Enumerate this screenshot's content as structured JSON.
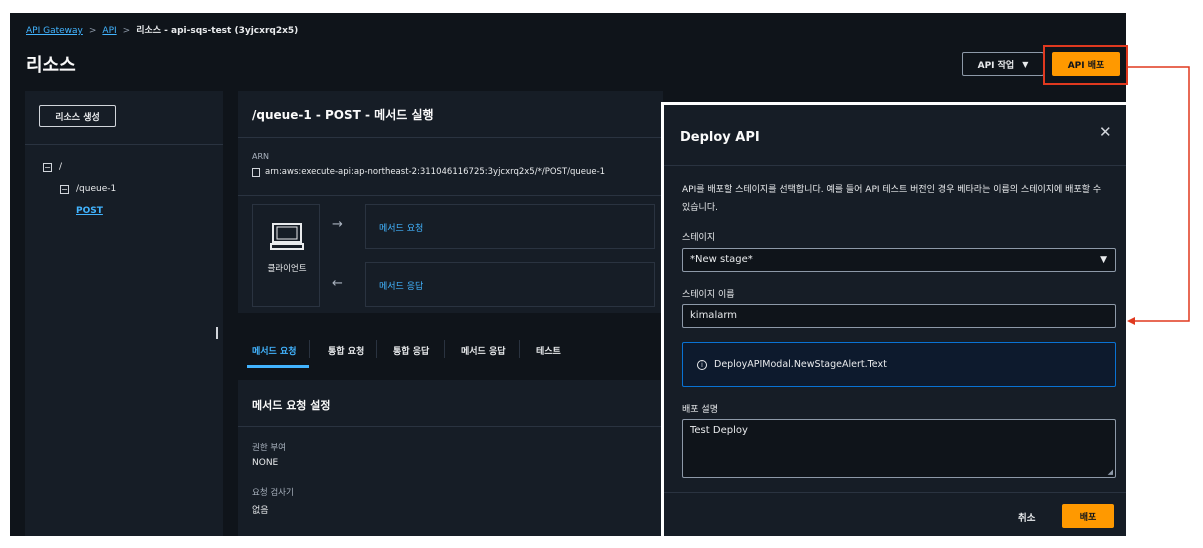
{
  "breadcrumb": {
    "item1": "API Gateway",
    "item2": "API",
    "current": "리소스 - api-sqs-test (3yjcxrq2x5)"
  },
  "header": {
    "title": "리소스",
    "api_actions_label": "API 작업",
    "deploy_label": "API 배포"
  },
  "left_panel": {
    "create_resource_label": "리소스 생성",
    "tree": {
      "root": "/",
      "child": "/queue-1",
      "method": "POST"
    }
  },
  "method_card": {
    "title": "/queue-1 - POST - 메서드 실행",
    "arn_label": "ARN",
    "arn_value": "arn:aws:execute-api:ap-northeast-2:311046116725:3yjcxrq2x5/*/POST/queue-1",
    "client_label": "클라이언트",
    "method_request_link": "메서드 요청",
    "method_response_link": "메서드 응답"
  },
  "tabs": [
    "메서드 요청",
    "통합 요청",
    "통합 응답",
    "메서드 응답",
    "테스트"
  ],
  "settings": {
    "title": "메서드 요청 설정",
    "auth_label": "권한 부여",
    "auth_value": "NONE",
    "validator_label": "요청 검사기",
    "validator_value": "없음"
  },
  "modal": {
    "title": "Deploy API",
    "description": "API를 배포할 스테이지를 선택합니다. 예를 들어 API 테스트 버전인 경우 베타라는 이름의 스테이지에 배포할 수 있습니다.",
    "stage_label": "스테이지",
    "stage_value": "*New stage*",
    "stage_name_label": "스테이지 이름",
    "stage_name_value": "kimalarm",
    "alert_text": "DeployAPIModal.NewStageAlert.Text",
    "desc_label": "배포 설명",
    "desc_value": "Test Deploy",
    "cancel_label": "취소",
    "deploy_label": "배포"
  },
  "colors": {
    "background": "#0f141a",
    "panel": "#161d26",
    "accent": "#ff9900",
    "link": "#42b4ff",
    "annotation": "#e0391f"
  }
}
